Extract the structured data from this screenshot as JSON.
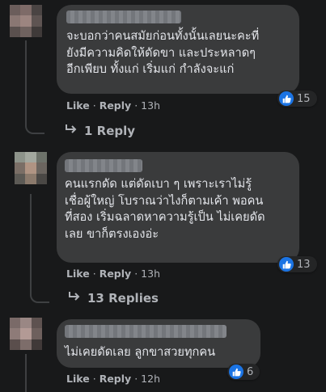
{
  "comments": [
    {
      "text": "จะบอกว่าคนสมัยก่อนทั้งนั้นเลยนะคะที่\nยังมีความคิดให้ดัดขา และประหลาดๆ\nอีกเพียบ ทั้งแก่ เริ่มแก่ กำลังจะแก่",
      "like_label": "Like",
      "reply_label": "Reply",
      "time": "13h",
      "reaction_count": "15",
      "reply_link": "1 Reply"
    },
    {
      "text": "คนแรกดัด แต่ดัดเบา ๆ เพราะเราไม่รู้\nเชื่อผู้ใหญ่ โบราณว่าไงก็ตามเค้า พอคน\nที่สอง เริ่มฉลาดหาความรู้เป็น ไม่เคยดัด\nเลย ขาก็ตรงเองอ่ะ",
      "like_label": "Like",
      "reply_label": "Reply",
      "time": "13h",
      "reaction_count": "13",
      "reply_link": "13 Replies"
    },
    {
      "text": "ไม่เคยดัดเลย ลูกขาสวยทุกคน",
      "like_label": "Like",
      "reply_label": "Reply",
      "time": "12h",
      "reaction_count": "6"
    }
  ],
  "separator": "·",
  "colors": {
    "background": "#18191a",
    "bubble": "#3a3b3c",
    "text": "#e4e6eb",
    "secondary_text": "#b0b3b8",
    "like_blue": "#1b74e4"
  },
  "icons": {
    "reaction": "thumbs-up-icon",
    "reply_arrow": "reply-arrow-icon"
  }
}
